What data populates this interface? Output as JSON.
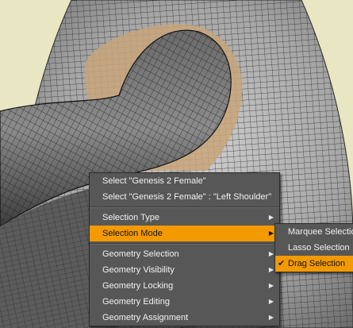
{
  "context_menu": {
    "top_items": [
      {
        "label": "Select \"Genesis 2 Female\""
      },
      {
        "label": "Select \"Genesis 2 Female\" : \"Left Shoulder\""
      }
    ],
    "items": [
      {
        "label": "Selection Type",
        "has_submenu": true,
        "active": false
      },
      {
        "label": "Selection Mode",
        "has_submenu": true,
        "active": true
      },
      {
        "label": "Geometry Selection",
        "has_submenu": true,
        "active": false
      },
      {
        "label": "Geometry Visibility",
        "has_submenu": true,
        "active": false
      },
      {
        "label": "Geometry Locking",
        "has_submenu": true,
        "active": false
      },
      {
        "label": "Geometry Editing",
        "has_submenu": true,
        "active": false
      },
      {
        "label": "Geometry Assignment",
        "has_submenu": true,
        "active": false
      }
    ],
    "submenu_arrow_glyph": "▶"
  },
  "selection_mode_submenu": {
    "items": [
      {
        "label": "Marquee Selection",
        "checked": false,
        "active": false
      },
      {
        "label": "Lasso Selection",
        "checked": false,
        "active": false
      },
      {
        "label": "Drag Selection",
        "checked": true,
        "active": true
      }
    ],
    "check_glyph": "✔"
  },
  "colors": {
    "menu_background": "#575757",
    "highlight": "#f39a00",
    "menu_text": "#f2f2f2",
    "viewport_background": "#e9e6c4",
    "mesh_fill": "#a9a9a9",
    "mesh_wire": "#2a2a2a",
    "selected_region": "#c8a57a"
  },
  "icons": {
    "submenu_arrow": "submenu-arrow-icon",
    "check": "checkmark-icon"
  }
}
